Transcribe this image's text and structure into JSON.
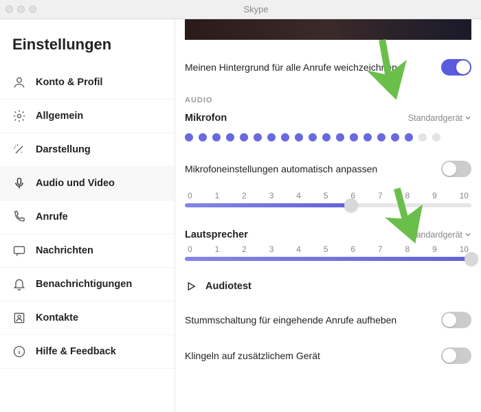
{
  "titlebar": {
    "app": "Skype"
  },
  "sidebar": {
    "title": "Einstellungen",
    "items": [
      {
        "label": "Konto & Profil"
      },
      {
        "label": "Allgemein"
      },
      {
        "label": "Darstellung"
      },
      {
        "label": "Audio und Video"
      },
      {
        "label": "Anrufe"
      },
      {
        "label": "Nachrichten"
      },
      {
        "label": "Benachrichtigungen"
      },
      {
        "label": "Kontakte"
      },
      {
        "label": "Hilfe & Feedback"
      }
    ]
  },
  "main": {
    "background_row": "Meinen Hintergrund für alle Anrufe weichzeichnen",
    "section_audio": "AUDIO",
    "mic_head": "Mikrofon",
    "mic_device": "Standardgerät",
    "mic_auto": "Mikrofoneinstellungen automatisch anpassen",
    "ticks": [
      "0",
      "1",
      "2",
      "3",
      "4",
      "5",
      "6",
      "7",
      "8",
      "9",
      "10"
    ],
    "speaker_head": "Lautsprecher",
    "speaker_device": "Standardgerät",
    "audiotest": "Audiotest",
    "unmute_row": "Stummschaltung für eingehende Anrufe aufheben",
    "ring_row": "Klingeln auf zusätzlichem Gerät",
    "mic_slider_pct": 58,
    "speaker_slider_pct": 100,
    "mic_level_active": 17,
    "mic_level_total": 19,
    "toggle_bg": true,
    "toggle_auto": false,
    "toggle_unmute": false,
    "toggle_ring": false
  }
}
